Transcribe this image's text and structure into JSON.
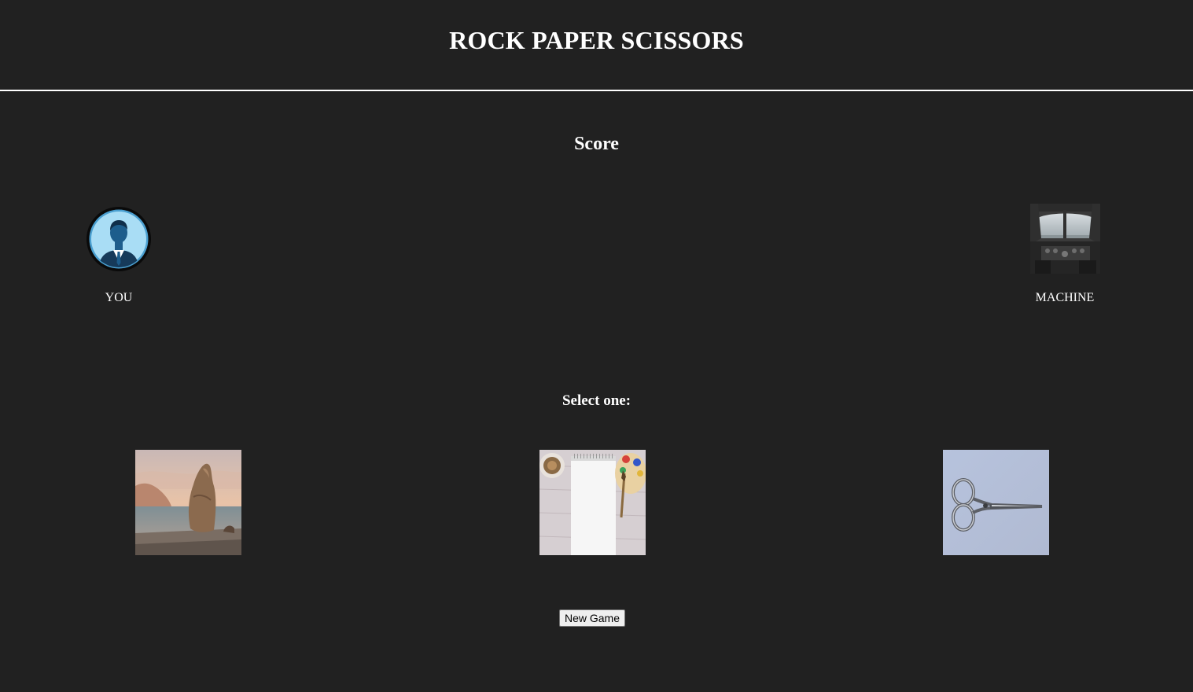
{
  "header": {
    "title": "ROCK PAPER SCISSORS"
  },
  "score": {
    "heading": "Score"
  },
  "player": {
    "label": "YOU",
    "icon": "person-avatar-icon"
  },
  "machine": {
    "label": "MACHINE",
    "icon": "airplane-cockpit-image"
  },
  "selection": {
    "heading": "Select one:",
    "choices": [
      {
        "name": "rock",
        "image": "rock-image"
      },
      {
        "name": "paper",
        "image": "paper-image"
      },
      {
        "name": "scissors",
        "image": "scissors-image"
      }
    ]
  },
  "controls": {
    "new_game_label": "New Game"
  },
  "colors": {
    "background": "#212121",
    "text": "#ffffff",
    "divider": "#ffffff"
  }
}
